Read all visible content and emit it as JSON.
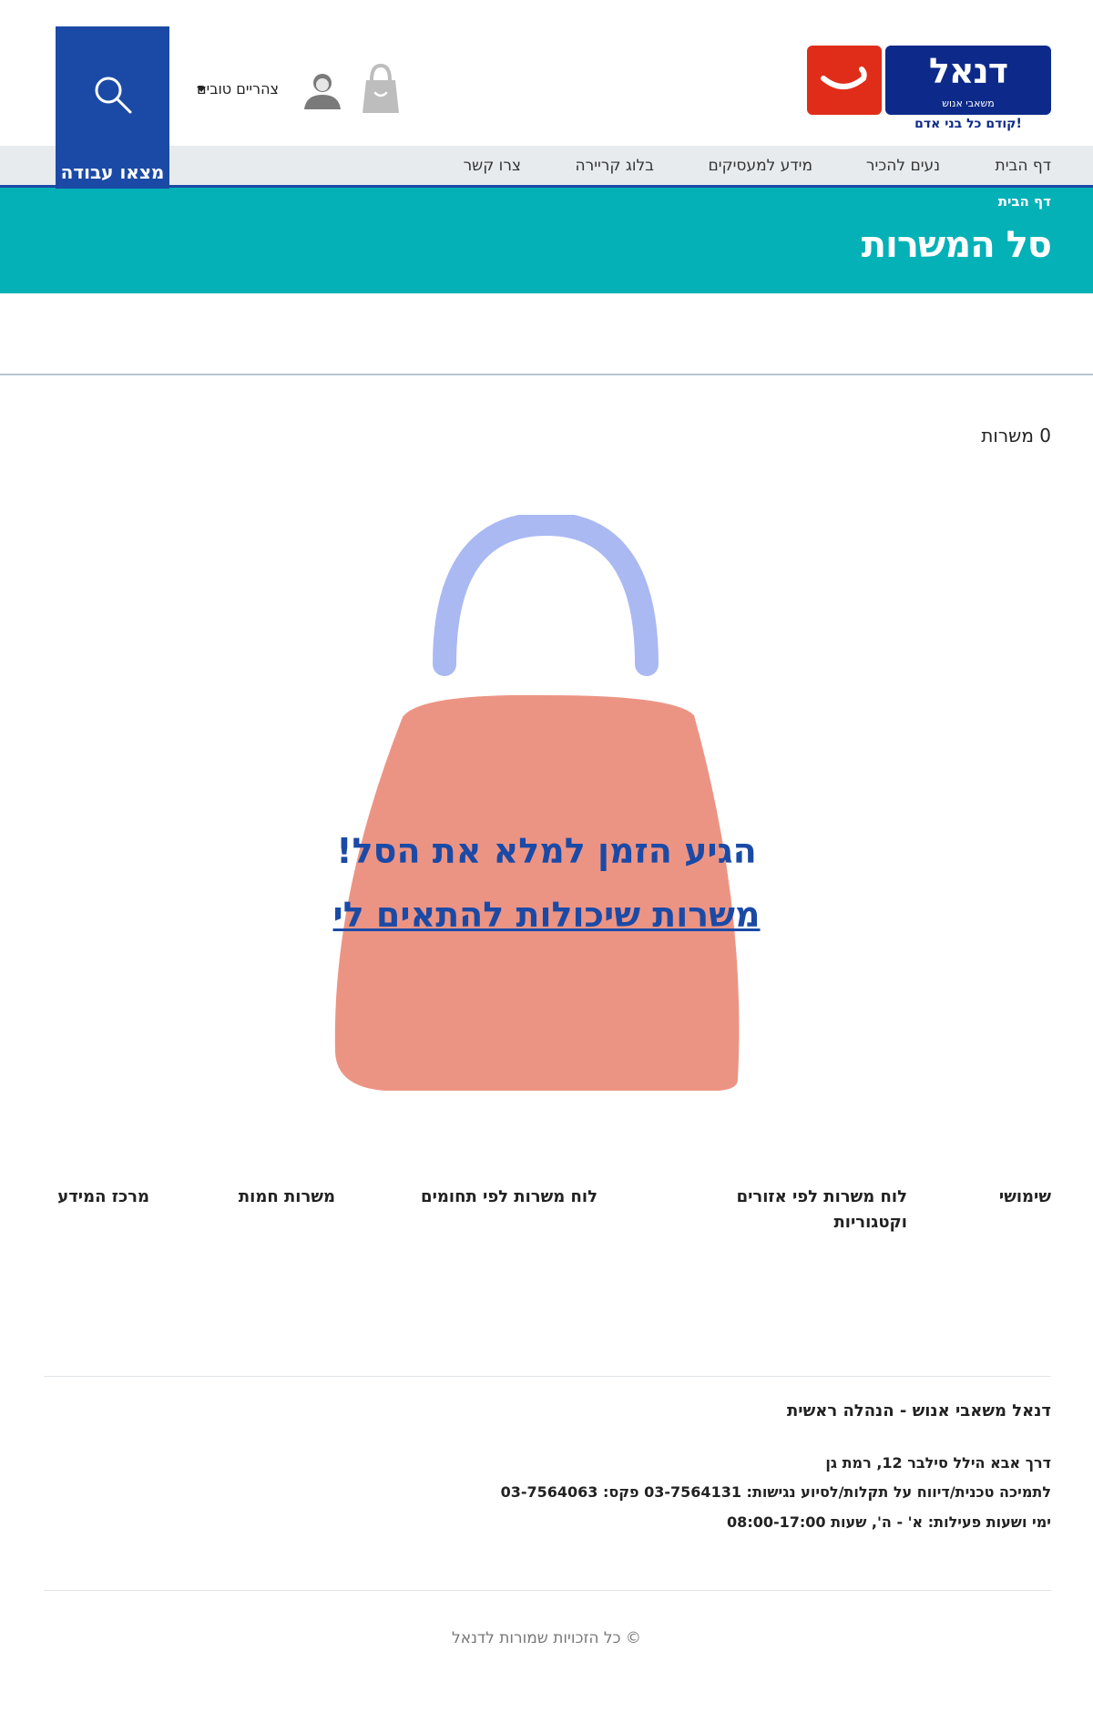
{
  "header": {
    "logo": {
      "wordmark": "דנאל",
      "subtitle": "משאבי אנוש",
      "tagline": "קודם כל בני אדם!"
    },
    "greeting": "צהריים טובים",
    "find_job_label": "מצאו עבודה"
  },
  "nav": {
    "items": [
      "דף הבית",
      "נעים להכיר",
      "מידע למעסיקים",
      "בלוג קריירה",
      "צרו קשר"
    ]
  },
  "banner": {
    "breadcrumb": "דף הבית",
    "title": "סל המשרות"
  },
  "results": {
    "count_text": "0 משרות"
  },
  "empty_state": {
    "headline": "הגיע הזמן למלא את הסל!",
    "link": "משרות שיכולות להתאים לי"
  },
  "footer": {
    "columns": [
      "שימושי",
      "לוח משרות לפי אזורים וקטגוריות",
      "לוח משרות לפי תחומים",
      "משרות חמות",
      "מרכז המידע"
    ],
    "company_name": "דנאל משאבי אנוש - הנהלה ראשית",
    "address": "דרך אבא הילל סילבר 12, רמת גן",
    "support": "לתמיכה טכנית/דיווח על תקלות/לסיוע נגישות: 03-7564131 פקס: 03-7564063",
    "hours": "ימי ושעות פעילות: א' - ה', שעות 08:00-17:00",
    "copyright": "© כל הזכויות שמורות לדנאל"
  },
  "colors": {
    "brand_blue": "#1b4aa6",
    "teal": "#03b1b7",
    "logo_red": "#e02d19",
    "logo_navy": "#0d2a8a",
    "bag_body": "#ec9484",
    "bag_handle": "#aab9f2"
  },
  "icons": {
    "cart": "shopping-bag-icon",
    "user": "user-icon",
    "search": "search-icon",
    "dropdown": "caret-down-icon"
  }
}
